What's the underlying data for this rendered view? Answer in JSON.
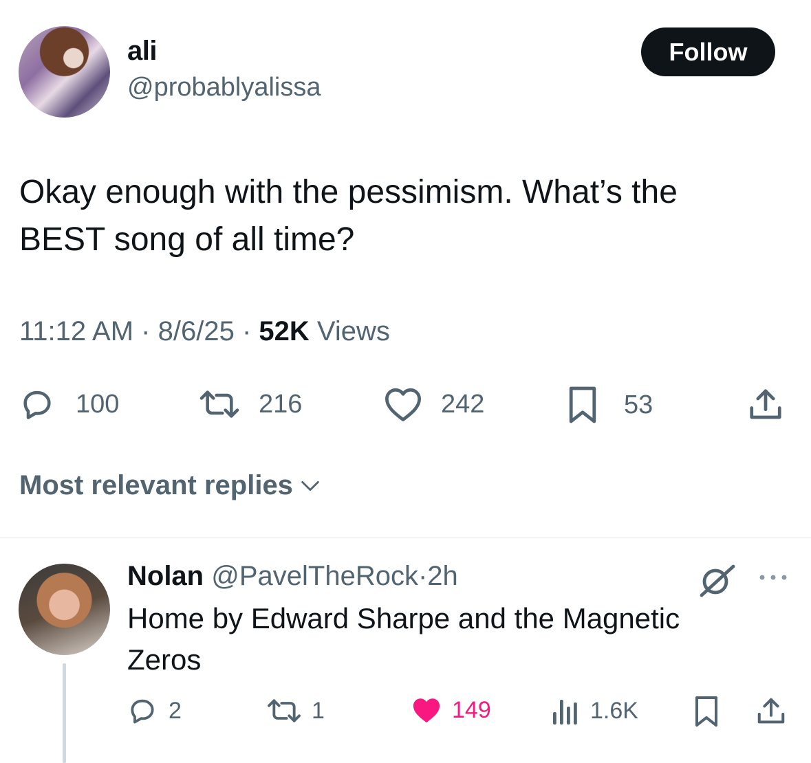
{
  "tweet": {
    "author_name": "ali",
    "author_handle": "@probablyalissa",
    "follow_label": "Follow",
    "text_line1": "Okay enough with the pessimism. What’s the",
    "text_line2": "BEST song of all time?",
    "time": "11:12 AM",
    "date": "8/6/25",
    "views_count": "52K",
    "views_label": "Views",
    "separator": "·",
    "stats": {
      "replies": "100",
      "retweets": "216",
      "likes": "242",
      "bookmarks": "53"
    }
  },
  "replies_sort": {
    "label": "Most relevant replies"
  },
  "reply": {
    "author_name": "Nolan",
    "author_handle": "@PavelTheRock",
    "separator": "·",
    "time": "2h",
    "text_line1": "Home by Edward Sharpe and the Magnetic",
    "text_line2": "Zeros",
    "stats": {
      "replies": "2",
      "retweets": "1",
      "likes": "149",
      "views": "1.6K"
    }
  },
  "colors": {
    "text_primary": "#0f1419",
    "text_secondary": "#536471",
    "like_pink": "#f91880",
    "follow_bg": "#0f1419"
  },
  "icons": [
    "reply-icon",
    "retweet-icon",
    "like-icon",
    "bookmark-icon",
    "share-icon",
    "chevron-down-icon",
    "grok-icon",
    "more-icon",
    "views-icon"
  ]
}
